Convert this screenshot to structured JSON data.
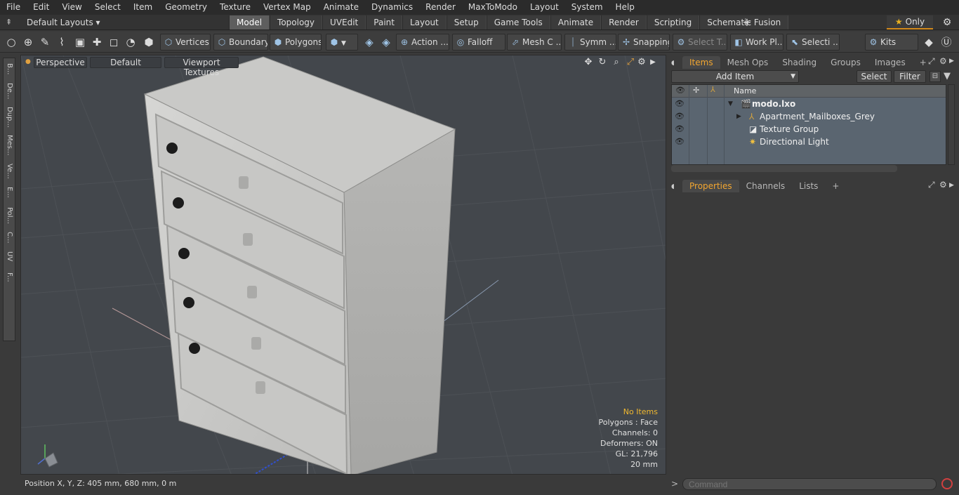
{
  "menu": [
    "File",
    "Edit",
    "View",
    "Select",
    "Item",
    "Geometry",
    "Texture",
    "Vertex Map",
    "Animate",
    "Dynamics",
    "Render",
    "MaxToModo",
    "Layout",
    "System",
    "Help"
  ],
  "layout": {
    "name": "Default Layouts ▾"
  },
  "tabs": [
    {
      "label": "Model",
      "active": true
    },
    {
      "label": "Topology"
    },
    {
      "label": "UVEdit"
    },
    {
      "label": "Paint"
    },
    {
      "label": "Layout"
    },
    {
      "label": "Setup"
    },
    {
      "label": "Game Tools"
    },
    {
      "label": "Animate"
    },
    {
      "label": "Render"
    },
    {
      "label": "Scripting"
    },
    {
      "label": "Schematic Fusion"
    }
  ],
  "only_label": "Only",
  "toolbar": {
    "vertices": "Vertices",
    "boundary": "Boundary",
    "polygons": "Polygons",
    "action": "Action ...",
    "falloff": "Falloff",
    "mesh": "Mesh C ...",
    "symmetry": "Symm ...",
    "snapping": "Snapping",
    "select_t": "Select T...",
    "work_plane": "Work Pl...",
    "selection": "Selecti ...",
    "kits": "Kits"
  },
  "left_tabs": [
    "B...",
    "De...",
    "Dup...",
    "Mes...",
    "Ve...",
    "E...",
    "Pol...",
    "C...",
    "UV",
    "F..."
  ],
  "viewport": {
    "view": "Perspective",
    "shading": "Default",
    "textures": "Viewport Textures",
    "hud": {
      "selection": "No Items",
      "polygons": "Polygons : Face",
      "channels": "Channels: 0",
      "deformers": "Deformers: ON",
      "gl": "GL: 21,796",
      "scale": "20 mm"
    }
  },
  "status": "Position X, Y, Z:   405 mm, 680 mm, 0 m",
  "items_panel": {
    "tabs": [
      "Items",
      "Mesh Ops",
      "Shading",
      "Groups",
      "Images"
    ],
    "add_item": "Add Item",
    "select": "Select",
    "filter": "Filter",
    "name_header": "Name",
    "tree": [
      {
        "label": "modo.lxo",
        "bold": true
      },
      {
        "label": "Apartment_Mailboxes_Grey"
      },
      {
        "label": "Texture Group"
      },
      {
        "label": "Directional Light"
      }
    ]
  },
  "props_panel": {
    "tabs": [
      "Properties",
      "Channels",
      "Lists"
    ]
  },
  "command": {
    "placeholder": "Command"
  },
  "colors": {
    "accent": "#f2a630",
    "viewport_bg": "#43474c",
    "tree_bg": "#5a6570"
  }
}
